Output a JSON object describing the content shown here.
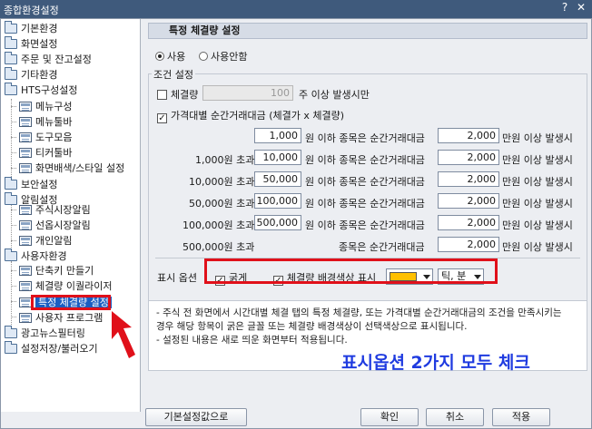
{
  "window": {
    "title": "종합환경설정",
    "help_glyph": "?",
    "close_glyph": "✕"
  },
  "tree": {
    "items": [
      {
        "label": "기본환경"
      },
      {
        "label": "화면설정"
      },
      {
        "label": "주문 및 잔고설정"
      },
      {
        "label": "기타환경"
      },
      {
        "label": "HTS구성설정"
      },
      {
        "label": "메뉴구성"
      },
      {
        "label": "메뉴툴바"
      },
      {
        "label": "도구모음"
      },
      {
        "label": "티커툴바"
      },
      {
        "label": "화면배색/스타일 설정"
      },
      {
        "label": "보안설정"
      },
      {
        "label": "알림설정"
      },
      {
        "label": "주식시장알림"
      },
      {
        "label": "선옵시장알림"
      },
      {
        "label": "개인알림"
      },
      {
        "label": "사용자환경"
      },
      {
        "label": "단축키 만들기"
      },
      {
        "label": "체결량 이퀄라이저"
      },
      {
        "label": "특정 체결량 설정"
      },
      {
        "label": "사용자 프로그램"
      },
      {
        "label": "광고뉴스필터링"
      },
      {
        "label": "설정저장/불러오기"
      }
    ]
  },
  "main": {
    "header": "특정 체결량 설정",
    "use_on": "사용",
    "use_off": "사용안함",
    "condition_label": "조건 설정",
    "volume": {
      "label": "체결량",
      "value": "100",
      "suffix": "주 이상 발생시만"
    },
    "amount_check_label": "가격대별 순간거래대금 (체결가 x 체결량)",
    "rows": [
      {
        "prefix": "",
        "price": "1,000",
        "mid": "원 이하 종목은 순간거래대금",
        "amount": "2,000",
        "suffix": "만원 이상 발생시"
      },
      {
        "prefix": "1,000원 초과",
        "price": "10,000",
        "mid": "원 이하 종목은 순간거래대금",
        "amount": "2,000",
        "suffix": "만원 이상 발생시"
      },
      {
        "prefix": "10,000원 초과",
        "price": "50,000",
        "mid": "원 이하 종목은 순간거래대금",
        "amount": "2,000",
        "suffix": "만원 이상 발생시"
      },
      {
        "prefix": "50,000원 초과",
        "price": "100,000",
        "mid": "원 이하 종목은 순간거래대금",
        "amount": "2,000",
        "suffix": "만원 이상 발생시"
      },
      {
        "prefix": "100,000원 초과",
        "price": "500,000",
        "mid": "원 이하 종목은 순간거래대금",
        "amount": "2,000",
        "suffix": "만원 이상 발생시"
      },
      {
        "prefix": "500,000원 초과",
        "price": "",
        "mid": "종목은 순간거래대금",
        "amount": "2,000",
        "suffix": "만원 이상 발생시"
      }
    ],
    "display_options": {
      "label": "표시 옵션",
      "bold": "굵게",
      "bg_color": "체결량 배경색상 표시",
      "color": "#ffc000",
      "unit": "틱, 분"
    },
    "notes": [
      "- 주식 전 화면에서 시간대별 체결 탭의 특정 체결량, 또는 가격대별 순간거래대금의 조건을 만족시키는",
      "경우 해당 항목이 굵은 글꼴 또는 체결량 배경색상이 선택색상으로 표시됩니다.",
      "- 설정된 내용은 새로 띄운 화면부터 적용됩니다."
    ],
    "annotation": "표시옵션 2가지 모두 체크"
  },
  "buttons": {
    "reset": "기본설정값으로",
    "ok": "확인",
    "cancel": "취소",
    "apply": "적용"
  },
  "colors": {
    "title_bar": "#3f5a7c",
    "highlight": "#e0101a",
    "annotation": "#1f3be0",
    "selection": "#1a5ec2"
  }
}
